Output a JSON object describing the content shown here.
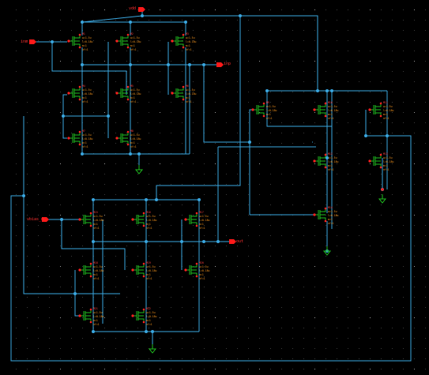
{
  "window": {
    "background": "#000000"
  },
  "colors": {
    "wire": "#3aa7e0",
    "device": "#20c020",
    "pin": "#ff1a1a",
    "label": "#ff9a1f",
    "ground": "#20c020",
    "grid": "#2a2a2a"
  },
  "pins": [
    {
      "id": "vdd",
      "label": "vdd"
    },
    {
      "id": "inm",
      "label": "inm"
    },
    {
      "id": "inp",
      "label": "inp"
    },
    {
      "id": "vbias",
      "label": "vbias_n"
    },
    {
      "id": "out",
      "label": "out"
    }
  ],
  "device_params": {
    "w": "w=1.5u",
    "l": "l=0.18u",
    "m": "m=1",
    "nf": "nf=1"
  },
  "devices": [
    {
      "name": "M1"
    },
    {
      "name": "M2"
    },
    {
      "name": "M3"
    },
    {
      "name": "M4"
    },
    {
      "name": "M5"
    },
    {
      "name": "M6"
    },
    {
      "name": "M7"
    },
    {
      "name": "M8"
    },
    {
      "name": "M9"
    },
    {
      "name": "M10"
    },
    {
      "name": "M11"
    },
    {
      "name": "M12"
    },
    {
      "name": "M13"
    },
    {
      "name": "M14"
    },
    {
      "name": "M15"
    },
    {
      "name": "M16"
    },
    {
      "name": "M17"
    },
    {
      "name": "M18"
    },
    {
      "name": "M19"
    },
    {
      "name": "M20"
    },
    {
      "name": "M21"
    },
    {
      "name": "M22"
    },
    {
      "name": "M23"
    },
    {
      "name": "M24"
    },
    {
      "name": "M25"
    }
  ]
}
